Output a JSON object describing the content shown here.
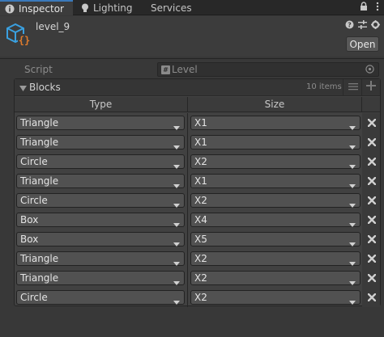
{
  "tabs": [
    {
      "label": "Inspector",
      "icon": "info-icon",
      "active": true
    },
    {
      "label": "Lighting",
      "icon": "lightbulb-icon",
      "active": false
    },
    {
      "label": "Services",
      "icon": "",
      "active": false
    }
  ],
  "header": {
    "asset_name": "level_9",
    "icon": "scriptable-object-icon",
    "open_label": "Open"
  },
  "script": {
    "label": "Script",
    "value": "Level"
  },
  "blocks": {
    "title": "Blocks",
    "count_label": "10 items",
    "columns": [
      "Type",
      "Size"
    ],
    "rows": [
      {
        "type": "Triangle",
        "size": "X1"
      },
      {
        "type": "Triangle",
        "size": "X1"
      },
      {
        "type": "Circle",
        "size": "X2"
      },
      {
        "type": "Triangle",
        "size": "X1"
      },
      {
        "type": "Circle",
        "size": "X2"
      },
      {
        "type": "Box",
        "size": "X4"
      },
      {
        "type": "Box",
        "size": "X5"
      },
      {
        "type": "Triangle",
        "size": "X2"
      },
      {
        "type": "Triangle",
        "size": "X2"
      },
      {
        "type": "Circle",
        "size": "X2"
      }
    ]
  },
  "colors": {
    "accent": "#3a79bb",
    "icon_blue": "#3aa0e0",
    "icon_orange": "#e07b2c"
  }
}
